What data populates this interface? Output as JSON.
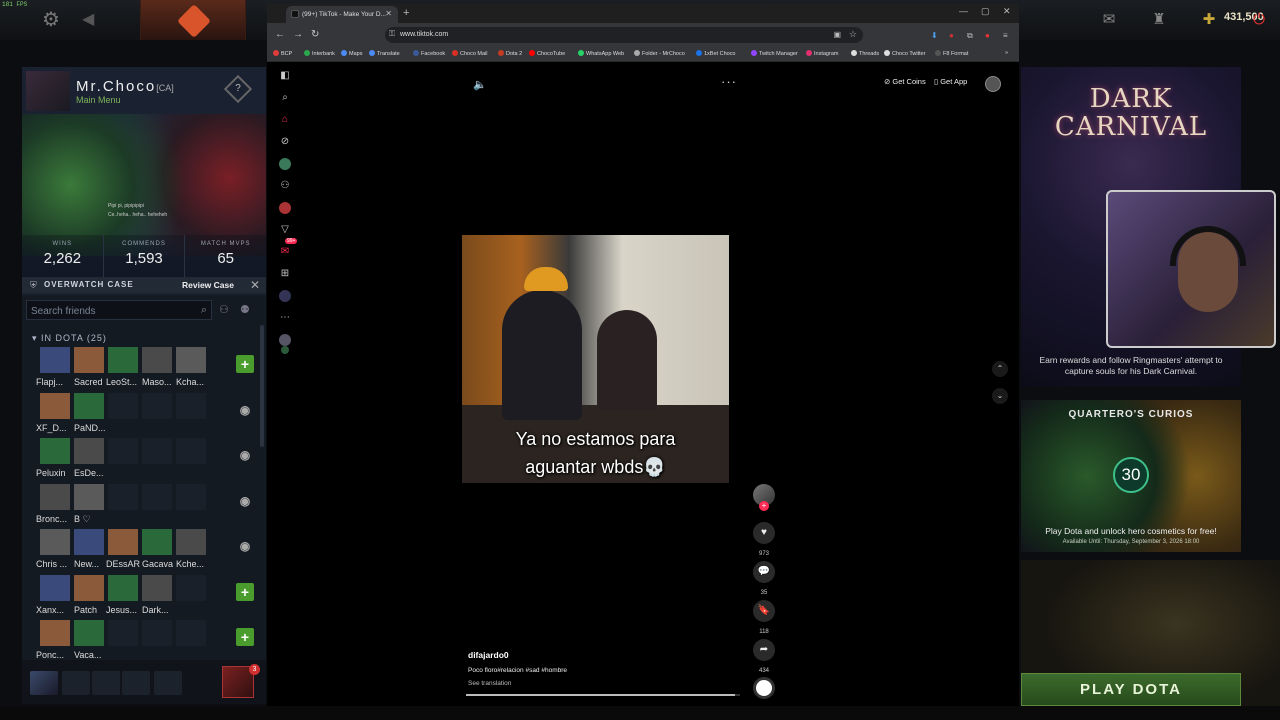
{
  "dota": {
    "fps": "181 FPS",
    "currency": "431,500",
    "profile": {
      "name": "Mr.Choco",
      "tag": "[CA]",
      "status": "Main Menu",
      "music_line1": "Pipi pi, pipipipipi",
      "music_line2": "Ce..heha.. heha.. heheheh",
      "stats": [
        {
          "label": "WINS",
          "value": "2,262"
        },
        {
          "label": "COMMENDS",
          "value": "1,593"
        },
        {
          "label": "MATCH MVPS",
          "value": "65"
        }
      ]
    },
    "overwatch": {
      "label": "OVERWATCH CASE",
      "button": "Review Case"
    },
    "friends": {
      "search_placeholder": "Search friends",
      "group_label": "IN DOTA (25)",
      "rows": [
        {
          "names": [
            "Flapj...",
            "Sacred",
            "LeoSt...",
            "Maso...",
            "Kcha..."
          ],
          "action": "plus"
        },
        {
          "names": [
            "XF_D...",
            "PaND..."
          ],
          "action": "eye"
        },
        {
          "names": [
            "Peluxin",
            "EsDe..."
          ],
          "action": "eye"
        },
        {
          "names": [
            "Bronc...",
            "B ♡"
          ],
          "action": "eye"
        },
        {
          "names": [
            "Chris ...",
            "New...",
            "DEssAR",
            "Gacava",
            "Kche..."
          ],
          "action": "eye"
        },
        {
          "names": [
            "Xanx...",
            "Patch",
            "Jesus...",
            "Dark..."
          ],
          "action": "plus"
        },
        {
          "names": [
            "Ponc...",
            "Vaca..."
          ],
          "action": "plus"
        }
      ]
    },
    "chat_badge": "3",
    "event": {
      "title": "DARK CARNIVAL",
      "desc": "Earn rewards and follow Ringmasters' attempt to capture souls for his Dark Carnival."
    },
    "curios": {
      "title": "QUARTERO'S CURIOS",
      "number": "30",
      "desc": "Play Dota and unlock hero cosmetics for free!",
      "available": "Available Until:  Thursday, September 3, 2026 18:00"
    },
    "play_button": "PLAY DOTA"
  },
  "browser": {
    "tab_title": "(99+) TikTok - Make Your D...",
    "url": "www.tiktok.com",
    "bookmarks": [
      "BCP",
      "Interbank",
      "Maps",
      "Translate",
      "Facebook",
      "Choco Mail",
      "Dota 2",
      "ChocoTube",
      "WhatsApp Web",
      "Folder - MrChoco",
      "1xBet Choco",
      "Twitch Manager",
      "Instagram",
      "Threads",
      "Choco Twitter",
      "F8 Format"
    ],
    "bookmark_colors": [
      "#e23b3b",
      "#2aa84a",
      "#4c8bf5",
      "#4c8bf5",
      "#3b5998",
      "#d93025",
      "#c23b22",
      "#ff0000",
      "#25d366",
      "#aaaaaa",
      "#1a73e8",
      "#9146ff",
      "#e1306c",
      "#dddddd",
      "#dddddd",
      "#555555"
    ]
  },
  "tiktok": {
    "get_coins": "Get Coins",
    "get_app": "Get App",
    "video_caption": "Ya no estamos para aguantar wbds💀",
    "caption_line1": "Ya no estamos para",
    "caption_line2": "aguantar wbds💀",
    "likes": "973",
    "comments": "35",
    "saves": "118",
    "shares": "434",
    "author": "difajardo0",
    "description": "Poco floro#relacion #sad #hombre",
    "see_translation": "See translation",
    "progress_fraction": 0.98,
    "notif_badge": "99+"
  }
}
